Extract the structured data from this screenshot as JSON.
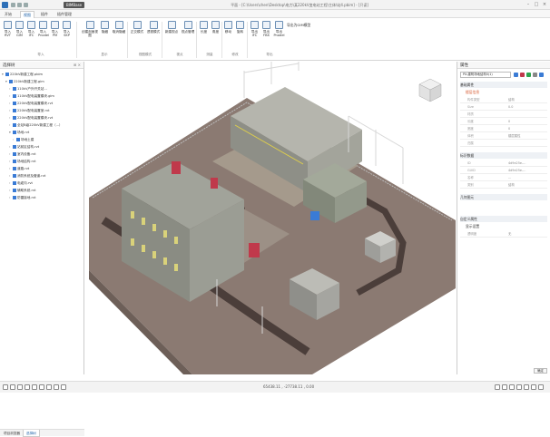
{
  "titlebar": {
    "app_name": "BIMBase",
    "file_path": "平面 - [C:\\Users\\chen\\Desktop\\电力\\某220kV变电站工程\\主体\\站4.pbim] - [只读]"
  },
  "menu_tabs": [
    "开始",
    "视图",
    "插件",
    "插件管理"
  ],
  "ribbon": {
    "buttons": [
      {
        "label": "导入",
        "label2": "RVT"
      },
      {
        "label": "导入",
        "label2": "GIM"
      },
      {
        "label": "导入",
        "label2": "IFC"
      },
      {
        "label": "导入",
        "label2": "Pnodel"
      },
      {
        "label": "导入",
        "label2": "PM"
      },
      {
        "label": "导入",
        "label2": "SKP"
      },
      {
        "label": "创建剖面视",
        "label2": "图"
      },
      {
        "label": "隐藏",
        "label2": ""
      },
      {
        "label": "取消隐藏",
        "label2": ""
      },
      {
        "label": "正交模式",
        "label2": ""
      },
      {
        "label": "透视模式",
        "label2": ""
      },
      {
        "label": "新建视点",
        "label2": ""
      },
      {
        "label": "视点管理",
        "label2": ""
      },
      {
        "label": "长度",
        "label2": ""
      },
      {
        "label": "角度",
        "label2": ""
      },
      {
        "label": "移动",
        "label2": ""
      },
      {
        "label": "旋转",
        "label2": ""
      },
      {
        "label": "导出",
        "label2": "IFC"
      },
      {
        "label": "导出",
        "label2": "FBX"
      },
      {
        "label": "导出",
        "label2": "Pnodel"
      }
    ],
    "export_menu_label": "导出为GIM模型",
    "groups": [
      "导入",
      "显示",
      "视图模式",
      "视点",
      "测量",
      "修改",
      "导出"
    ]
  },
  "left_panel": {
    "title": "选择树",
    "tree": [
      "220kV新建工程.pbim",
      "220kV新建工程.gim",
      "110kV户外开关站...",
      "110kV配电装置模块.gim",
      "220kV配电装置模块.rvt",
      "220kV配电装置室.rvt",
      "220kV配电装置模块.rvt",
      "全站B级220kV新建工程（...）",
      "场地.rvt",
      "场地土建",
      "站前区结构.rvt",
      "室内设备.rvt",
      "场地结构.rvt",
      "道路.rvt",
      "消防系统及管道.rvt",
      "电缆沟.rvt",
      "辅助系统.rvt",
      "防雷接地.rvt"
    ],
    "tabs": [
      "项目浏览器",
      "选择树"
    ]
  },
  "right_panel": {
    "title": "属性",
    "type_select": "PX-建筑场地结构0(1)",
    "sections": [
      {
        "title": "基础属性"
      },
      {
        "title": "楼层信息"
      },
      {
        "title": "标识数据"
      },
      {
        "title": "几何图元"
      },
      {
        "title": "自定义属性"
      },
      {
        "title": "显示设置"
      }
    ],
    "rows": [
      {
        "key": "构件类型",
        "value": "结构"
      },
      {
        "key": "Size",
        "value": "0.0"
      },
      {
        "key": "材质",
        "value": ""
      },
      {
        "key": "长度",
        "value": "0"
      },
      {
        "key": "宽度",
        "value": "0"
      },
      {
        "key": "体积",
        "value": "楼层属性"
      },
      {
        "key": "归属",
        "value": ""
      },
      {
        "key": "ID",
        "value": "4d9e25e-..."
      },
      {
        "key": "GUID",
        "value": "4d9e25e-..."
      },
      {
        "key": "名称",
        "value": "..."
      },
      {
        "key": "类别",
        "value": "结构"
      },
      {
        "key": "透明度",
        "value": "无"
      }
    ],
    "ok_label": "确定"
  },
  "statusbar": {
    "coords": "65438.11 , -27738.11 , 0.00"
  }
}
